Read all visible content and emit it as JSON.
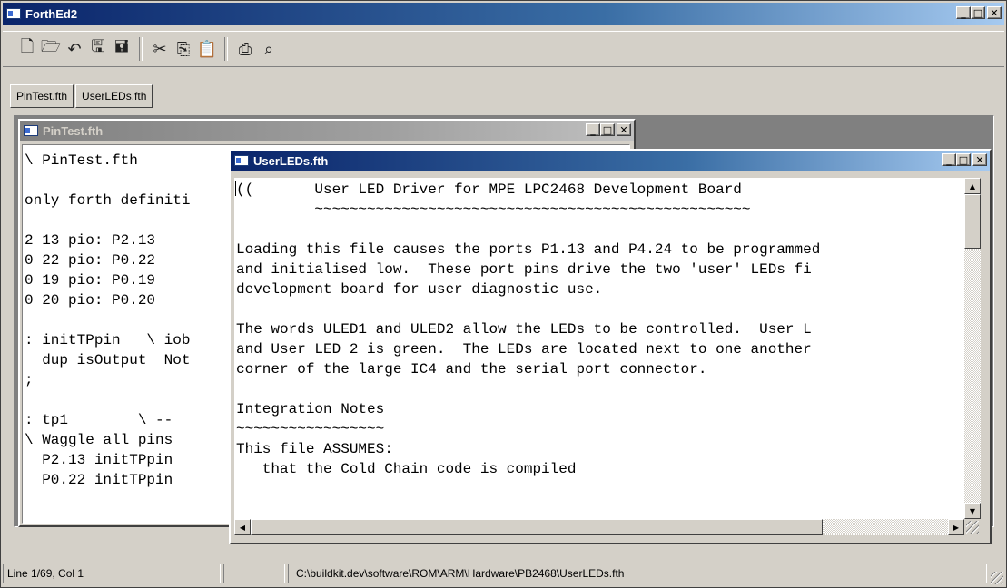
{
  "app": {
    "title": "ForthEd2"
  },
  "toolbar": {
    "icons": [
      "new-file-icon",
      "open-folder-icon",
      "reopen-icon",
      "save-icon",
      "save-all-icon",
      "cut-icon",
      "copy-icon",
      "paste-icon",
      "print-icon",
      "find-icon"
    ]
  },
  "tabs": [
    {
      "label": "PinTest.fth"
    },
    {
      "label": "UserLEDs.fth"
    }
  ],
  "pintest": {
    "title": "PinTest.fth",
    "lines": [
      "\\ PinTest.fth",
      "",
      "only forth definiti",
      "",
      "2 13 pio: P2.13",
      "0 22 pio: P0.22",
      "0 19 pio: P0.19",
      "0 20 pio: P0.20",
      "",
      ": initTPpin   \\ iob",
      "  dup isOutput  Not",
      ";",
      "",
      ": tp1        \\ --",
      "\\ Waggle all pins",
      "  P2.13 initTPpin",
      "  P0.22 initTPpin"
    ]
  },
  "userleds": {
    "title": "UserLEDs.fth",
    "lines": [
      "((       User LED Driver for MPE LPC2468 Development Board",
      "         ~~~~~~~~~~~~~~~~~~~~~~~~~~~~~~~~~~~~~~~~~~~~~~~~~~",
      "",
      "Loading this file causes the ports P1.13 and P4.24 to be programmed",
      "and initialised low.  These port pins drive the two 'user' LEDs fi",
      "development board for user diagnostic use.",
      "",
      "The words ULED1 and ULED2 allow the LEDs to be controlled.  User L",
      "and User LED 2 is green.  The LEDs are located next to one another",
      "corner of the large IC4 and the serial port connector.",
      "",
      "Integration Notes",
      "~~~~~~~~~~~~~~~~~",
      "This file ASSUMES:",
      "   that the Cold Chain code is compiled"
    ]
  },
  "status": {
    "position": "Line 1/69, Col 1",
    "mode": "",
    "path": "C:\\buildkit.dev\\software\\ROM\\ARM\\Hardware\\PB2468\\UserLEDs.fth"
  },
  "colors": {
    "title_active": "#0a246a",
    "title_inactive": "#808080",
    "face": "#d4d0c8"
  }
}
